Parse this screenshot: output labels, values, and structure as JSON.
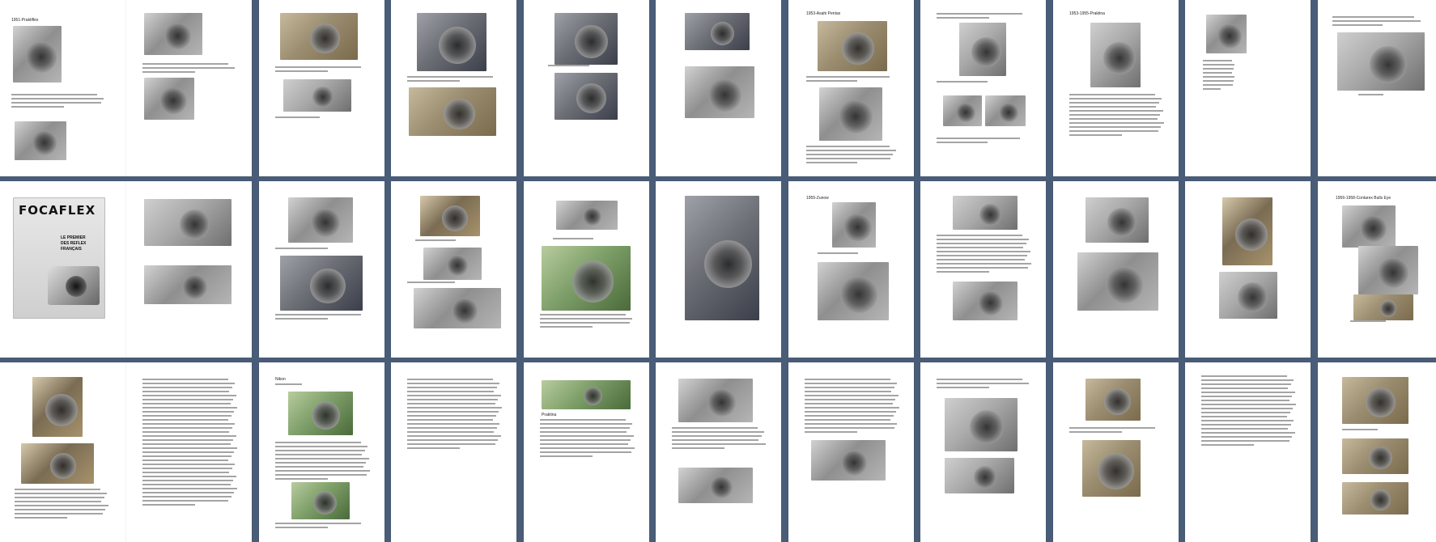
{
  "viewer": {
    "background": "#4a5d78",
    "rows": 3,
    "columns": 11
  },
  "texts": {
    "p1_title": "1951-Praktiflex",
    "p7_title": "1953-Asahi Pentax",
    "p9_title": "1953-1955-Praktina",
    "p17_title": "1955-Zunow",
    "p22_title": "1956-1958-Contarex Bulls Eye",
    "p24_title": "Nikon",
    "p25_title": "Praktina",
    "p12_logo": "FOCAFLEX",
    "p12_slogan1": "LE PREMIER",
    "p12_slogan2": "DES REFLEX",
    "p12_slogan3": "FRANÇAIS"
  }
}
